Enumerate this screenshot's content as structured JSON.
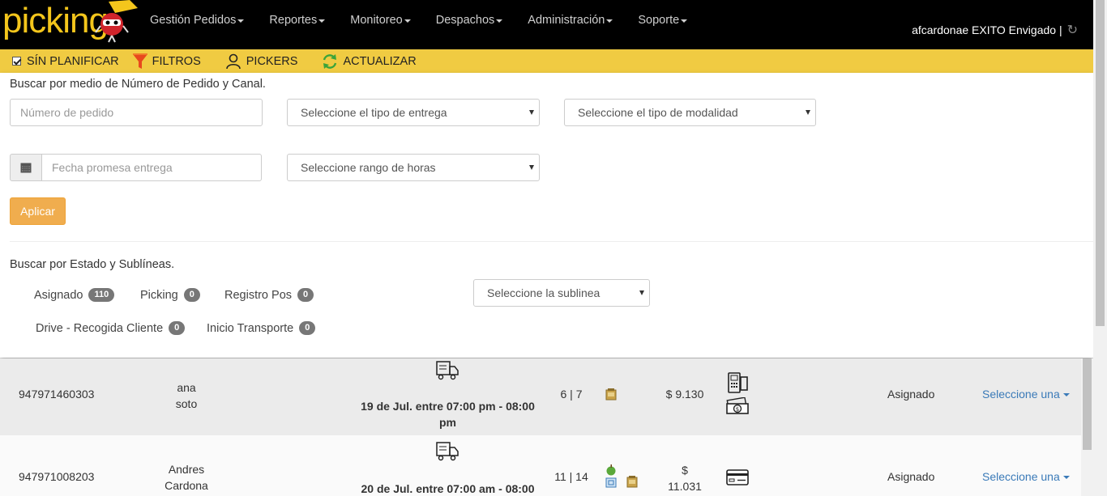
{
  "app": {
    "logo_text": "picking",
    "nav": [
      {
        "label": "Gestión Pedidos"
      },
      {
        "label": "Reportes"
      },
      {
        "label": "Monitoreo"
      },
      {
        "label": "Despachos"
      },
      {
        "label": "Administración"
      },
      {
        "label": "Soporte"
      }
    ],
    "user_label": "afcardonae EXITO Envigado |",
    "refresh_icon": "refresh-icon",
    "brand_color": "#f0cb42"
  },
  "toolbar": {
    "sin_planificar": "SÍN PLANIFICAR",
    "sin_planificar_checked": true,
    "filtros": "FILTROS",
    "pickers": "PICKERS",
    "actualizar": "ACTUALIZAR"
  },
  "search": {
    "heading_order": "Buscar por medio de Número de Pedido y Canal.",
    "order_placeholder": "Número de pedido",
    "delivery_type": "Seleccione el tipo de entrega",
    "modality_type": "Seleccione el tipo de modalidad",
    "date_placeholder": "Fecha promesa entrega",
    "hour_range": "Seleccione rango de horas",
    "apply_label": "Aplicar",
    "heading_state": "Buscar por Estado y Sublíneas.",
    "sublinea": "Seleccione la sublinea",
    "states": [
      {
        "label": "Asignado",
        "count": "110"
      },
      {
        "label": "Picking",
        "count": "0"
      },
      {
        "label": "Registro Pos",
        "count": "0"
      },
      {
        "label": "Drive - Recogida Cliente",
        "count": "0"
      },
      {
        "label": "Inicio Transporte",
        "count": "0"
      }
    ]
  },
  "orders": [
    {
      "id": "947971460303",
      "name_first": "ana",
      "name_last": "soto",
      "delivery": "19 de Jul. entre 07:00 pm - 08:00 pm",
      "units": "6 | 7",
      "amount": "$ 9.130",
      "payment_icons": [
        "pos-terminal-icon",
        "cash-icon"
      ],
      "status": "Asignado",
      "action": "Seleccione una"
    },
    {
      "id": "947971008203",
      "name_first": "Andres",
      "name_last": "Cardona",
      "delivery": "20 de Jul. entre 07:00 am - 08:00",
      "units": "11 | 14",
      "amount_symbol": "$",
      "amount_value": "11.031",
      "payment_icons": [
        "credit-card-icon"
      ],
      "status": "Asignado",
      "action": "Seleccione una"
    }
  ]
}
